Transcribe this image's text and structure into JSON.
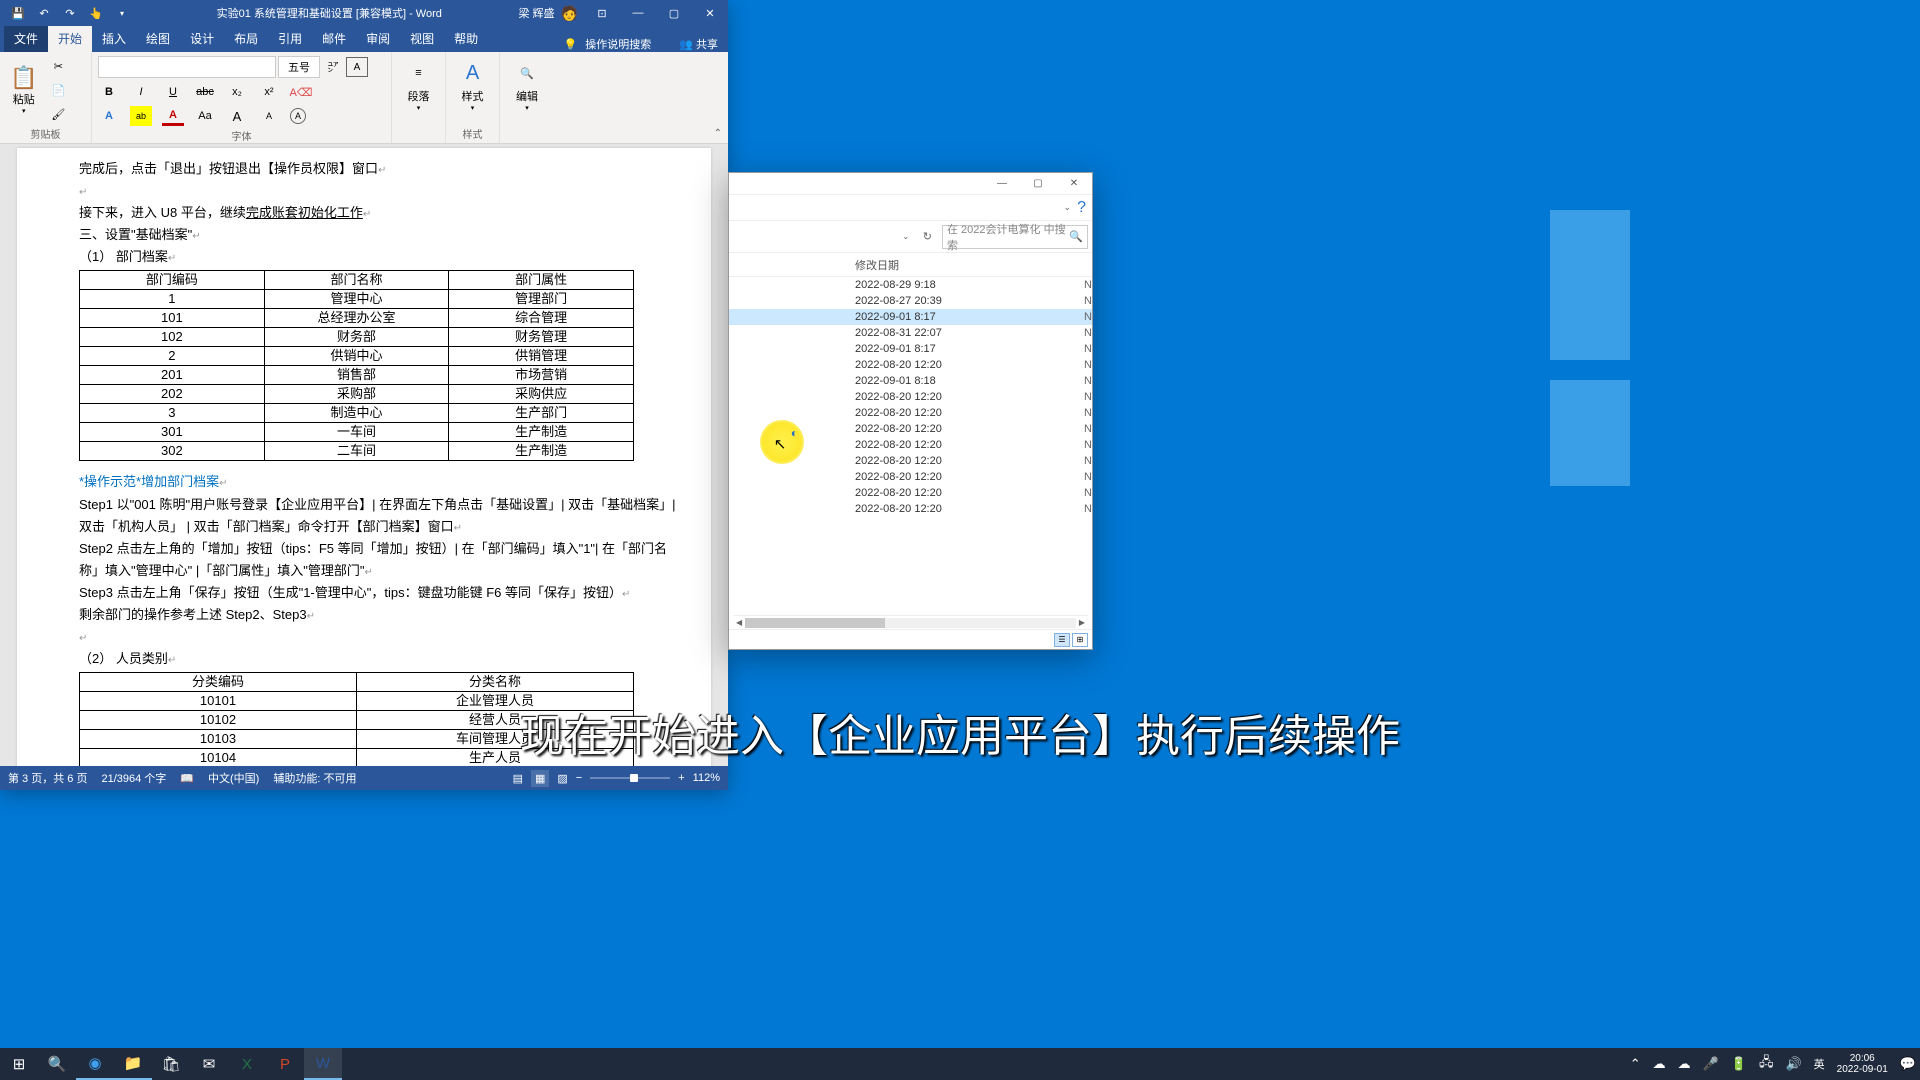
{
  "word": {
    "title": "实验01 系统管理和基础设置 [兼容模式] - Word",
    "user": "梁 辉盛",
    "tabs": {
      "file": "文件",
      "home": "开始",
      "insert": "插入",
      "draw": "绘图",
      "design": "设计",
      "layout": "布局",
      "references": "引用",
      "mailings": "邮件",
      "review": "审阅",
      "view": "视图",
      "help": "帮助",
      "search": "操作说明搜索",
      "share": "共享"
    },
    "groups": {
      "clipboard": "剪贴板",
      "paste": "粘贴",
      "font": "字体",
      "paragraph": "段落",
      "styles": "样式",
      "editing": "编辑"
    },
    "font_size": "五号",
    "content": {
      "line1": "完成后，点击「退出」按钮退出【操作员权限】窗口",
      "line2a": "接下来，进入 U8 平台，继续",
      "line2b": "完成账套初始化工作",
      "line3": "三、设置\"基础档案\"",
      "line4": "（1）  部门档案",
      "table1_head": [
        "部门编码",
        "部门名称",
        "部门属性"
      ],
      "table1_rows": [
        [
          "1",
          "管理中心",
          "管理部门"
        ],
        [
          "101",
          "总经理办公室",
          "综合管理"
        ],
        [
          "102",
          "财务部",
          "财务管理"
        ],
        [
          "2",
          "供销中心",
          "供销管理"
        ],
        [
          "201",
          "销售部",
          "市场营销"
        ],
        [
          "202",
          "采购部",
          "采购供应"
        ],
        [
          "3",
          "制造中心",
          "生产部门"
        ],
        [
          "301",
          "一车间",
          "生产制造"
        ],
        [
          "302",
          "二车间",
          "生产制造"
        ]
      ],
      "demo_label": "*操作示范*增加部门档案",
      "step1": "Step1 以\"001 陈明\"用户账号登录【企业应用平台】| 在界面左下角点击「基础设置」| 双击「基础档案」| 双击「机构人员」 | 双击「部门档案」命令打开【部门档案】窗口",
      "step2": "Step2 点击左上角的「增加」按钮（tips：F5 等同「增加」按钮）| 在「部门编码」填入\"1\"| 在「部门名称」填入\"管理中心\" |「部门属性」填入\"管理部门\"",
      "step3": "Step3 点击左上角「保存」按钮（生成\"1-管理中心\"，tips：键盘功能键 F6 等同「保存」按钮）",
      "step4": "剩余部门的操作参考上述 Step2、Step3",
      "line5": "（2）  人员类别",
      "table2_head": [
        "分类编码",
        "分类名称"
      ],
      "table2_rows": [
        [
          "10101",
          "企业管理人员"
        ],
        [
          "10102",
          "经营人员"
        ],
        [
          "10103",
          "车间管理人员"
        ],
        [
          "10104",
          "生产人员"
        ]
      ]
    },
    "status": {
      "page": "第 3 页，共 6 页",
      "words": "21/3964 个字",
      "lang": "中文(中国)",
      "a11y": "辅助功能: 不可用",
      "zoom": "112%"
    }
  },
  "explorer": {
    "search_placeholder": "在 2022会计电算化 中搜索",
    "col_date": "修改日期",
    "rows": [
      {
        "date": "2022-08-29 9:18"
      },
      {
        "date": "2022-08-27 20:39"
      },
      {
        "date": "2022-09-01 8:17",
        "sel": true
      },
      {
        "date": "2022-08-31 22:07"
      },
      {
        "date": "2022-09-01 8:17"
      },
      {
        "date": "2022-08-20 12:20"
      },
      {
        "date": "2022-09-01 8:18"
      },
      {
        "date": "2022-08-20 12:20"
      },
      {
        "date": "2022-08-20 12:20"
      },
      {
        "date": "2022-08-20 12:20"
      },
      {
        "date": "2022-08-20 12:20"
      },
      {
        "date": "2022-08-20 12:20"
      },
      {
        "date": "2022-08-20 12:20"
      },
      {
        "date": "2022-08-20 12:20"
      },
      {
        "date": "2022-08-20 12:20"
      }
    ]
  },
  "subtitle": "现在开始进入【企业应用平台】执行后续操作",
  "tray": {
    "ime": "英",
    "time": "20:06",
    "date": "2022-09-01"
  }
}
